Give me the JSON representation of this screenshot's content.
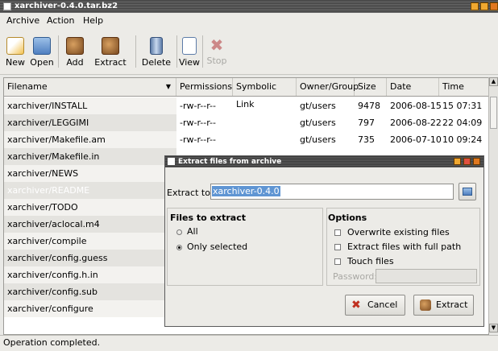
{
  "window": {
    "title": "xarchiver-0.4.0.tar.bz2"
  },
  "menu": [
    {
      "label": "Archive"
    },
    {
      "label": "Action"
    },
    {
      "label": "Help"
    }
  ],
  "toolbar": {
    "new": "New",
    "open": "Open",
    "add": "Add",
    "extract": "Extract",
    "delete": "Delete",
    "view": "View",
    "stop": "Stop"
  },
  "columns": {
    "filename": "Filename",
    "permissions": "Permissions",
    "symlink": "Symbolic Link",
    "owner": "Owner/Group",
    "size": "Size",
    "date": "Date",
    "time": "Time"
  },
  "rows": [
    {
      "name": "xarchiver/INSTALL",
      "perm": "-rw-r--r--",
      "owner": "gt/users",
      "size": "9478",
      "date": "2006-08-15",
      "time": "15 07:31"
    },
    {
      "name": "xarchiver/LEGGIMI",
      "perm": "-rw-r--r--",
      "owner": "gt/users",
      "size": "797",
      "date": "2006-08-22",
      "time": "22 04:09"
    },
    {
      "name": "xarchiver/Makefile.am",
      "perm": "-rw-r--r--",
      "owner": "gt/users",
      "size": "735",
      "date": "2006-07-10",
      "time": "10 09:24"
    },
    {
      "name": "xarchiver/Makefile.in"
    },
    {
      "name": "xarchiver/NEWS"
    },
    {
      "name": "xarchiver/README"
    },
    {
      "name": "xarchiver/TODO"
    },
    {
      "name": "xarchiver/aclocal.m4"
    },
    {
      "name": "xarchiver/compile"
    },
    {
      "name": "xarchiver/config.guess"
    },
    {
      "name": "xarchiver/config.h.in"
    },
    {
      "name": "xarchiver/config.sub"
    },
    {
      "name": "xarchiver/configure"
    }
  ],
  "status": "Operation completed.",
  "dialog": {
    "title": "Extract files from archive",
    "extract_to_label": "Extract to:",
    "extract_to_value": "xarchiver-0.4.0",
    "files_title": "Files to extract",
    "opt_all": "All",
    "opt_selected": "Only selected",
    "options_title": "Options",
    "overwrite": "Overwrite existing files",
    "fullpath": "Extract files with full path",
    "touch": "Touch files",
    "password_label": "Password:",
    "cancel": "Cancel",
    "extract": "Extract"
  },
  "colors": {
    "selection": "#6a9fd8",
    "accent": "#e8a020"
  }
}
